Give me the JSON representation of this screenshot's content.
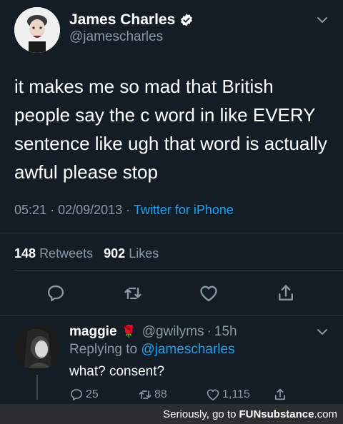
{
  "tweet": {
    "author_name": "James Charles",
    "author_handle": "@jamescharles",
    "text": "it makes me so mad that British people say the c word in like EVERY sentence like ugh that word is actually awful please stop",
    "time": "05:21",
    "date": "02/09/2013",
    "source": "Twitter for iPhone",
    "retweets_count": "148",
    "retweets_label": "Retweets",
    "likes_count": "902",
    "likes_label": "Likes"
  },
  "reply": {
    "author_name": "maggie",
    "author_handle": "@gwilyms",
    "age": "15h",
    "replying_label": "Replying to",
    "replying_to": "@jamescharles",
    "text": "what? consent?",
    "reply_count": "25",
    "retweet_count": "88",
    "like_count": "1,115"
  },
  "watermark": {
    "text": "Seriously, go to",
    "brand": "FUNsubstance",
    "tld": ".com"
  },
  "colors": {
    "background": "#141d26",
    "muted": "#8899a6",
    "link": "#1da1f2"
  },
  "icons": [
    "verified-badge-icon",
    "chevron-down-icon",
    "reply-icon",
    "retweet-icon",
    "like-icon",
    "share-icon",
    "rose-emoji"
  ]
}
